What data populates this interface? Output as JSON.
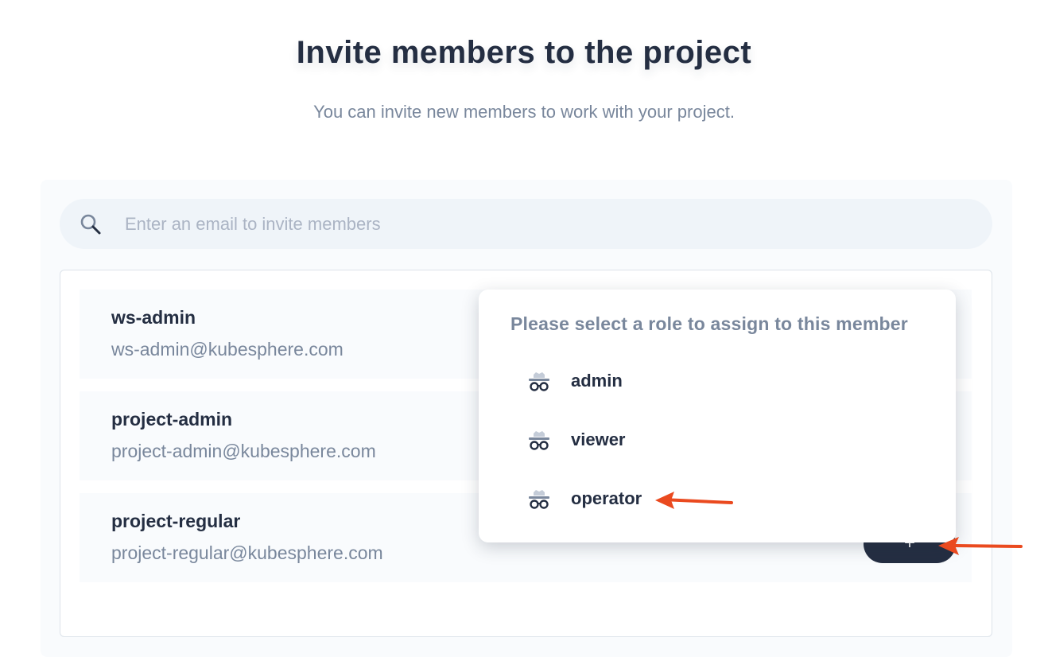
{
  "header": {
    "title": "Invite members to the project",
    "subtitle": "You can invite new members to work with your project."
  },
  "search": {
    "placeholder": "Enter an email to invite members",
    "icon": "search-icon"
  },
  "members": [
    {
      "name": "ws-admin",
      "email": "ws-admin@kubesphere.com"
    },
    {
      "name": "project-admin",
      "email": "project-admin@kubesphere.com"
    },
    {
      "name": "project-regular",
      "email": "project-regular@kubesphere.com"
    }
  ],
  "role_dropdown": {
    "title": "Please select a role to assign to this member",
    "roles": [
      {
        "label": "admin",
        "icon": "role-icon"
      },
      {
        "label": "viewer",
        "icon": "role-icon"
      },
      {
        "label": "operator",
        "icon": "role-icon"
      }
    ]
  },
  "assign_button": {
    "label": "+"
  },
  "colors": {
    "primary_dark": "#242e42",
    "muted_text": "#79879c",
    "annotation_arrow": "#ea4a1f"
  }
}
